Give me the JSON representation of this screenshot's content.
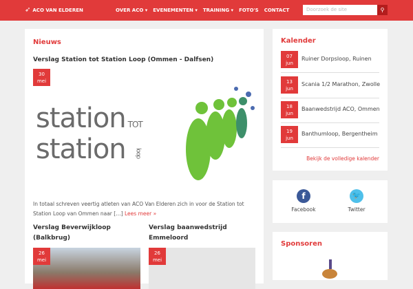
{
  "header": {
    "logo": "ACO VAN ELDEREN",
    "nav": [
      "OVER ACO ▾",
      "EVENEMENTEN ▾",
      "TRAINING ▾",
      "FOTO'S",
      "CONTACT"
    ],
    "search_placeholder": "Doorzoek de site"
  },
  "news": {
    "heading": "Nieuws",
    "featured": {
      "title": "Verslag Station tot Station Loop (Ommen - Dalfsen)",
      "day": "30",
      "month": "mei",
      "logo_text": [
        "station",
        "TOT",
        "station",
        "loop"
      ],
      "excerpt": "In totaal schreven veertig atleten van ACO Van Elderen zich in voor de Station tot Station Loop van Ommen naar […]",
      "read_more": "Lees meer »"
    },
    "posts": [
      {
        "title": "Verslag Beverwijkloop (Balkbrug)",
        "day": "26",
        "month": "mei"
      },
      {
        "title": "Verslag baanwedstrijd Emmeloord",
        "day": "26",
        "month": "mei"
      }
    ]
  },
  "calendar": {
    "heading": "Kalender",
    "events": [
      {
        "day": "07",
        "month": "jun",
        "name": "Ruiner Dorpsloop, Ruinen"
      },
      {
        "day": "13",
        "month": "jun",
        "name": "Scania 1/2 Marathon, Zwolle"
      },
      {
        "day": "18",
        "month": "jun",
        "name": "Baanwedstrijd ACO, Ommen"
      },
      {
        "day": "19",
        "month": "jun",
        "name": "Banthumloop, Bergentheim"
      }
    ],
    "link": "Bekijk de volledige kalender"
  },
  "social": {
    "facebook": "Facebook",
    "twitter": "Twitter"
  },
  "sponsors": {
    "heading": "Sponsoren"
  }
}
